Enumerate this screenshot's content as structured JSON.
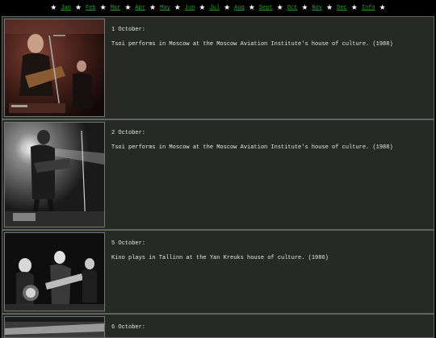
{
  "nav": {
    "items": [
      "Jan",
      "Feb",
      "Mar",
      "Apr",
      "May",
      "Jun",
      "Jul",
      "Aug",
      "Sept",
      "Oct",
      "Nov",
      "Dec",
      "Info"
    ],
    "star_glyph": "★",
    "link_color": "#2e9f2e"
  },
  "entries": [
    {
      "date": "1 October:",
      "description": "Tsoi performs in Moscow at the Moscow Aviation Institute's house of culture. (1988)"
    },
    {
      "date": "2 October:",
      "description": "Tsoi performs in Moscow at the Moscow Aviation Institute's house of culture. (1988)"
    },
    {
      "date": "5 October:",
      "description": "Kino plays in Tallinn at the Yan Kreuks house of culture. (1986)"
    },
    {
      "date": "6 October:",
      "description": ""
    }
  ],
  "colors": {
    "page_background": "#000000",
    "panel_background": "#262925",
    "panel_border": "#5a6a55",
    "text": "#e6e6e6"
  }
}
